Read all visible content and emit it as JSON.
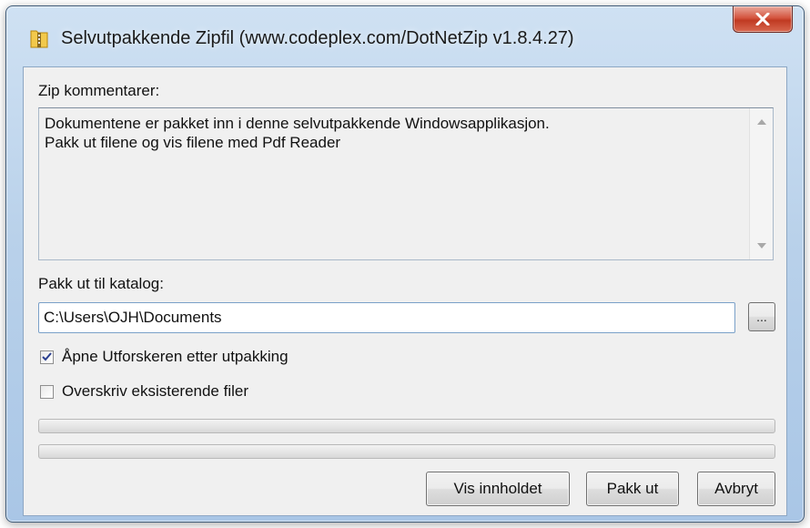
{
  "window": {
    "title": "Selvutpakkende Zipfil (www.codeplex.com/DotNetZip v1.8.4.27)",
    "icons": {
      "app": "zip-folder-icon",
      "close": "close-icon"
    },
    "close_label": "x"
  },
  "comments": {
    "label": "Zip kommentarer:",
    "text": "Dokumentene er pakket inn i denne selvutpakkende Windowsapplikasjon.\nPakk ut filene og vis filene med Pdf Reader"
  },
  "extract": {
    "label": "Pakk ut til katalog:",
    "path_value": "C:\\Users\\OJH\\Documents",
    "browse_label": "..."
  },
  "options": [
    {
      "label": "Åpne Utforskeren etter utpakking",
      "checked": true
    },
    {
      "label": "Overskriv eksisterende filer",
      "checked": false
    }
  ],
  "progress": [
    {
      "value": 0
    },
    {
      "value": 0
    }
  ],
  "buttons": {
    "show_contents": "Vis innholdet",
    "extract": "Pakk ut",
    "cancel": "Avbryt"
  },
  "colors": {
    "close_button": "#c03a22",
    "progress_fill": "#06b025",
    "input_border": "#7aa0c8"
  }
}
